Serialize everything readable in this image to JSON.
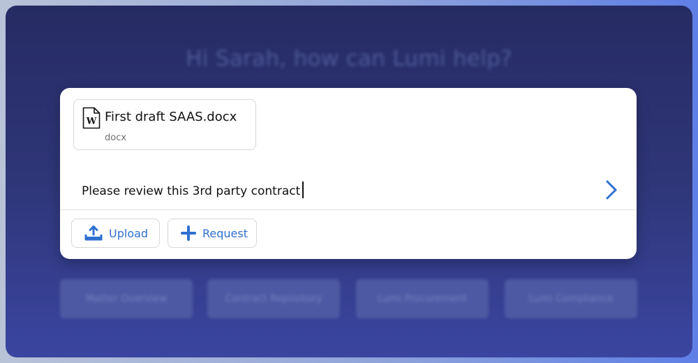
{
  "greeting": "Hi Sarah, how can Lumi help?",
  "attachment": {
    "name": "First draft SAAS.docx",
    "type": "docx",
    "icon": "word-document-icon"
  },
  "prompt": {
    "value": "Please review this 3rd party contract"
  },
  "actions": {
    "upload_label": "Upload",
    "request_label": "Request"
  },
  "quick_actions": [
    {
      "label": "Matter Overview"
    },
    {
      "label": "Contract Repository"
    },
    {
      "label": "Lumi Procurement"
    },
    {
      "label": "Lumi Compliance"
    }
  ],
  "colors": {
    "accent": "#2f6fd0",
    "background_top": "#262b63",
    "background_bottom": "#3a45a0"
  }
}
